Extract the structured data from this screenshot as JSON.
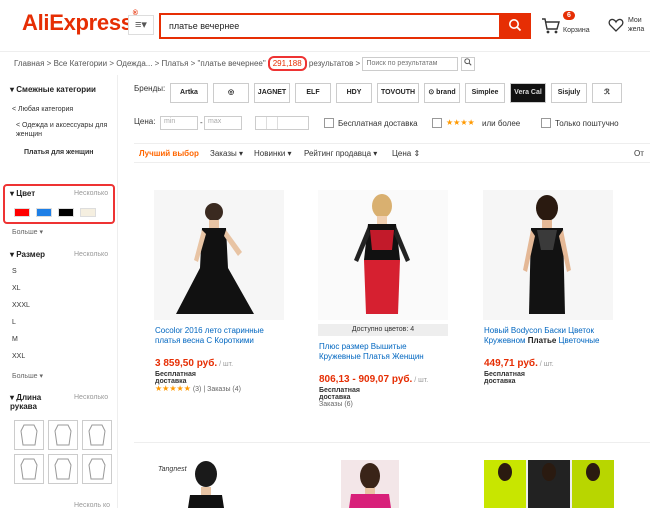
{
  "header": {
    "logo_text": "AliExpress",
    "logo_mark": "®",
    "category_button": "≡▾",
    "search_value": "платье вечернее",
    "cart_count": "6",
    "cart_label": "Корзина",
    "wish_label_1": "Мои",
    "wish_label_2": "жела"
  },
  "breadcrumb": {
    "path": "Главная > Все Категории > Одежда... > Платья > \"платье вечернее\"",
    "count": "291,188",
    "suffix": " результатов >",
    "search_placeholder": "Поиск по результатам"
  },
  "sidebar": {
    "related_title": "Смежные категории",
    "any_category": "< Любая категория",
    "parent_category": "< Одежда и аксессуары для женщин",
    "current_category": "Платья для женщин",
    "color_title": "Цвет",
    "color_multi": "Несколько",
    "colors": [
      "#ff0000",
      "#1e7fe6",
      "#000000",
      "#f5efe0"
    ],
    "more_1": "Больше ▾",
    "size_title": "Размер",
    "size_multi": "Несколько",
    "sizes": [
      "S",
      "XL",
      "XXXL",
      "L",
      "M",
      "XXL"
    ],
    "more_2": "Больше ▾",
    "sleeve_title": "Длина рукава",
    "sleeve_multi": "Несколько",
    "bottom_cut": "Несколь ко"
  },
  "filters": {
    "brands_label": "Бренды:",
    "brands": [
      "Artka",
      "◎",
      "JAGNET",
      "ELF SACK",
      "HDY",
      "TOVOUTH",
      "⊙ brand",
      "Simplee",
      "Vera Cal",
      "Sisjuly",
      "ℛ"
    ],
    "price_label": "Цена:",
    "price_min": "min",
    "price_dash": "-",
    "price_max": "max",
    "free_shipping": "Бесплатная доставка",
    "stars": "★★★★",
    "or_more": "или более",
    "single_only": "Только поштучно"
  },
  "sort": {
    "best": "Лучший выбор",
    "orders": "Заказы ▾",
    "newest": "Новинки ▾",
    "seller_rating": "Рейтинг продавца ▾",
    "price": "Цена ⇕",
    "right": "От"
  },
  "products": [
    {
      "title": "Cocolor 2016 лето старинные платья весна С Короткими",
      "price": "3 859,50 руб.",
      "unit": " / шт.",
      "shipping": "Бесплатная доставка",
      "stars": "★★★★★",
      "reviews": "(3)",
      "orders": "Заказы (4)"
    },
    {
      "colors_avail": "Доступно цветов: 4",
      "title": "Плюс размер Вышитые Кружевные Платья Женщин",
      "price": "806,13 - 909,07 руб.",
      "unit": " / шт.",
      "shipping": "Бесплатная доставка",
      "orders": "Заказы (6)"
    },
    {
      "title_a": "Новый Bodycon Баски Цветок Кружевном ",
      "title_b": "Платье",
      "title_c": " Цветочные",
      "price": "449,71 руб.",
      "unit": " / шт.",
      "shipping": "Бесплатная доставка"
    }
  ],
  "row2": {
    "brand_tag": "Tangnest"
  }
}
